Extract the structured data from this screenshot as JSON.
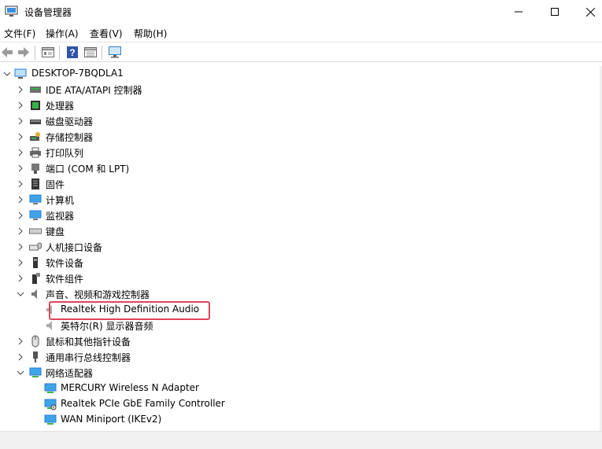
{
  "window": {
    "title": "设备管理器",
    "minimize_label": "minimize",
    "maximize_label": "maximize",
    "close_label": "close"
  },
  "menu": [
    "文件(F)",
    "操作(A)",
    "查看(V)",
    "帮助(H)"
  ],
  "toolbar": {
    "buttons": [
      "back-arrow-icon",
      "forward-arrow-icon",
      "properties-icon",
      "help-icon",
      "details-icon",
      "monitor-scan-icon"
    ]
  },
  "tree": {
    "root": "DESKTOP-7BQDLA1",
    "categories": [
      {
        "label": "IDE ATA/ATAPI 控制器",
        "icon": "ide-controller-icon",
        "expanded": false
      },
      {
        "label": "处理器",
        "icon": "processor-icon",
        "expanded": false
      },
      {
        "label": "磁盘驱动器",
        "icon": "disk-drive-icon",
        "expanded": false
      },
      {
        "label": "存储控制器",
        "icon": "storage-controller-icon",
        "expanded": false
      },
      {
        "label": "打印队列",
        "icon": "printer-icon",
        "expanded": false
      },
      {
        "label": "端口 (COM 和 LPT)",
        "icon": "port-icon",
        "expanded": false
      },
      {
        "label": "固件",
        "icon": "firmware-icon",
        "expanded": false
      },
      {
        "label": "计算机",
        "icon": "computer-icon",
        "expanded": false
      },
      {
        "label": "监视器",
        "icon": "monitor-icon",
        "expanded": false
      },
      {
        "label": "键盘",
        "icon": "keyboard-icon",
        "expanded": false
      },
      {
        "label": "人机接口设备",
        "icon": "hid-icon",
        "expanded": false
      },
      {
        "label": "软件设备",
        "icon": "software-device-icon",
        "expanded": false
      },
      {
        "label": "软件组件",
        "icon": "software-component-icon",
        "expanded": false
      },
      {
        "label": "声音、视频和游戏控制器",
        "icon": "speaker-icon",
        "expanded": true,
        "children": [
          "Realtek High Definition Audio",
          "英特尔(R) 显示器音频"
        ]
      },
      {
        "label": "鼠标和其他指针设备",
        "icon": "mouse-icon",
        "expanded": false
      },
      {
        "label": "通用串行总线控制器",
        "icon": "usb-icon",
        "expanded": false
      },
      {
        "label": "网络适配器",
        "icon": "network-adapter-icon",
        "expanded": true,
        "children": [
          "MERCURY Wireless N Adapter",
          "Realtek PCIe GbE Family Controller",
          "WAN Miniport (IKEv2)"
        ]
      }
    ]
  },
  "colors": {
    "highlight_border": "#e0455d",
    "blue_icon": "#2a7bd4",
    "text": "#000000"
  }
}
